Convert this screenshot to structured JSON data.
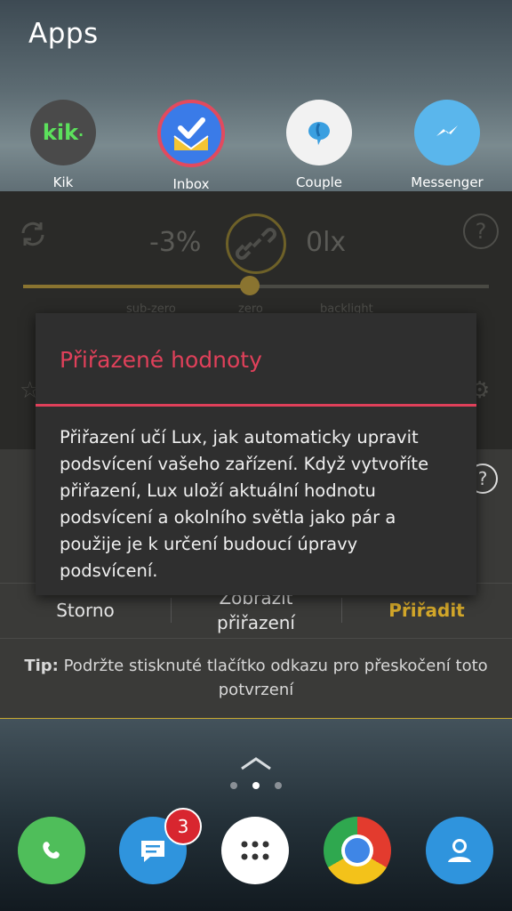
{
  "header": {
    "title": "Apps"
  },
  "apps": [
    {
      "label": "Kik",
      "icon": "kik-icon",
      "color": "#4a4a4a"
    },
    {
      "label": "Inbox",
      "icon": "inbox-icon",
      "color": "#3a7be8"
    },
    {
      "label": "Couple",
      "icon": "couple-icon",
      "color": "#f2f2f2"
    },
    {
      "label": "Messenger",
      "icon": "messenger-icon",
      "color": "#5ab6ec"
    }
  ],
  "lux": {
    "brightness_value": "-3%",
    "lux_value": "0lx",
    "ticks": {
      "sub_zero": "sub-zero",
      "zero": "zero",
      "backlight": "backlight"
    }
  },
  "dialog": {
    "title": "Přiřazené hodnoty",
    "body": "Přiřazení učí Lux, jak automaticky upravit podsvícení vašeho zařízení. Když vytvoříte přiřazení, Lux uloží aktuální hodnotu podsvícení a okolního světla jako pár a použije je k určení budoucí úpravy podsvícení.",
    "accent": "#e0405a"
  },
  "actions": {
    "cancel": "Storno",
    "show_line1": "Zobrazit",
    "show_line2": "přiřazení",
    "assign": "Přiřadit",
    "assign_color": "#d4a82a"
  },
  "tip": {
    "label": "Tip:",
    "text": "Podržte stisknuté tlačítko odkazu pro přeskočení toto potvrzení"
  },
  "dock": {
    "messages_badge": "3",
    "items": [
      "phone-icon",
      "messages-icon",
      "app-drawer-icon",
      "chrome-icon",
      "contacts-icon"
    ]
  }
}
